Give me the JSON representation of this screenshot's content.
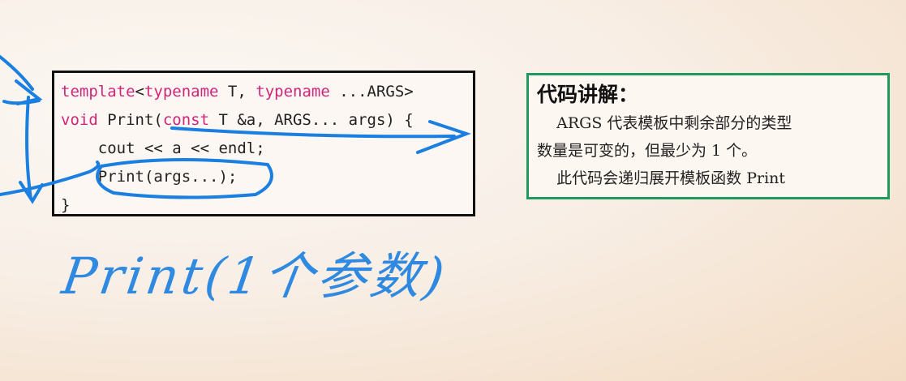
{
  "code": {
    "lines": [
      {
        "parts": [
          {
            "t": "template",
            "kw": true
          },
          {
            "t": "<",
            "kw": false
          },
          {
            "t": "typename",
            "kw": true
          },
          {
            "t": " T, ",
            "kw": false
          },
          {
            "t": "typename",
            "kw": true
          },
          {
            "t": " ...ARGS>",
            "kw": false
          }
        ]
      },
      {
        "parts": [
          {
            "t": "void",
            "kw": true
          },
          {
            "t": " Print(",
            "kw": false
          },
          {
            "t": "const",
            "kw": true
          },
          {
            "t": " T &a, ARGS... args) {",
            "kw": false
          }
        ]
      },
      {
        "parts": [
          {
            "t": "    cout << a << endl;",
            "kw": false
          }
        ]
      },
      {
        "parts": [
          {
            "t": "    Print(args...);",
            "kw": false
          }
        ]
      },
      {
        "parts": [
          {
            "t": "}",
            "kw": false
          }
        ]
      }
    ]
  },
  "explanation": {
    "title": "代码讲解：",
    "line1": "    ARGS 代表模板中剩余部分的类型",
    "line2": "数量是可变的，但最少为 1 个。",
    "line3": "    此代码会递归展开模板函数 Print"
  },
  "handwriting": "Print(1个参数)",
  "colors": {
    "keyword": "#d0257a",
    "ink": "#1a7fe0",
    "green_border": "#1f9a5e"
  }
}
